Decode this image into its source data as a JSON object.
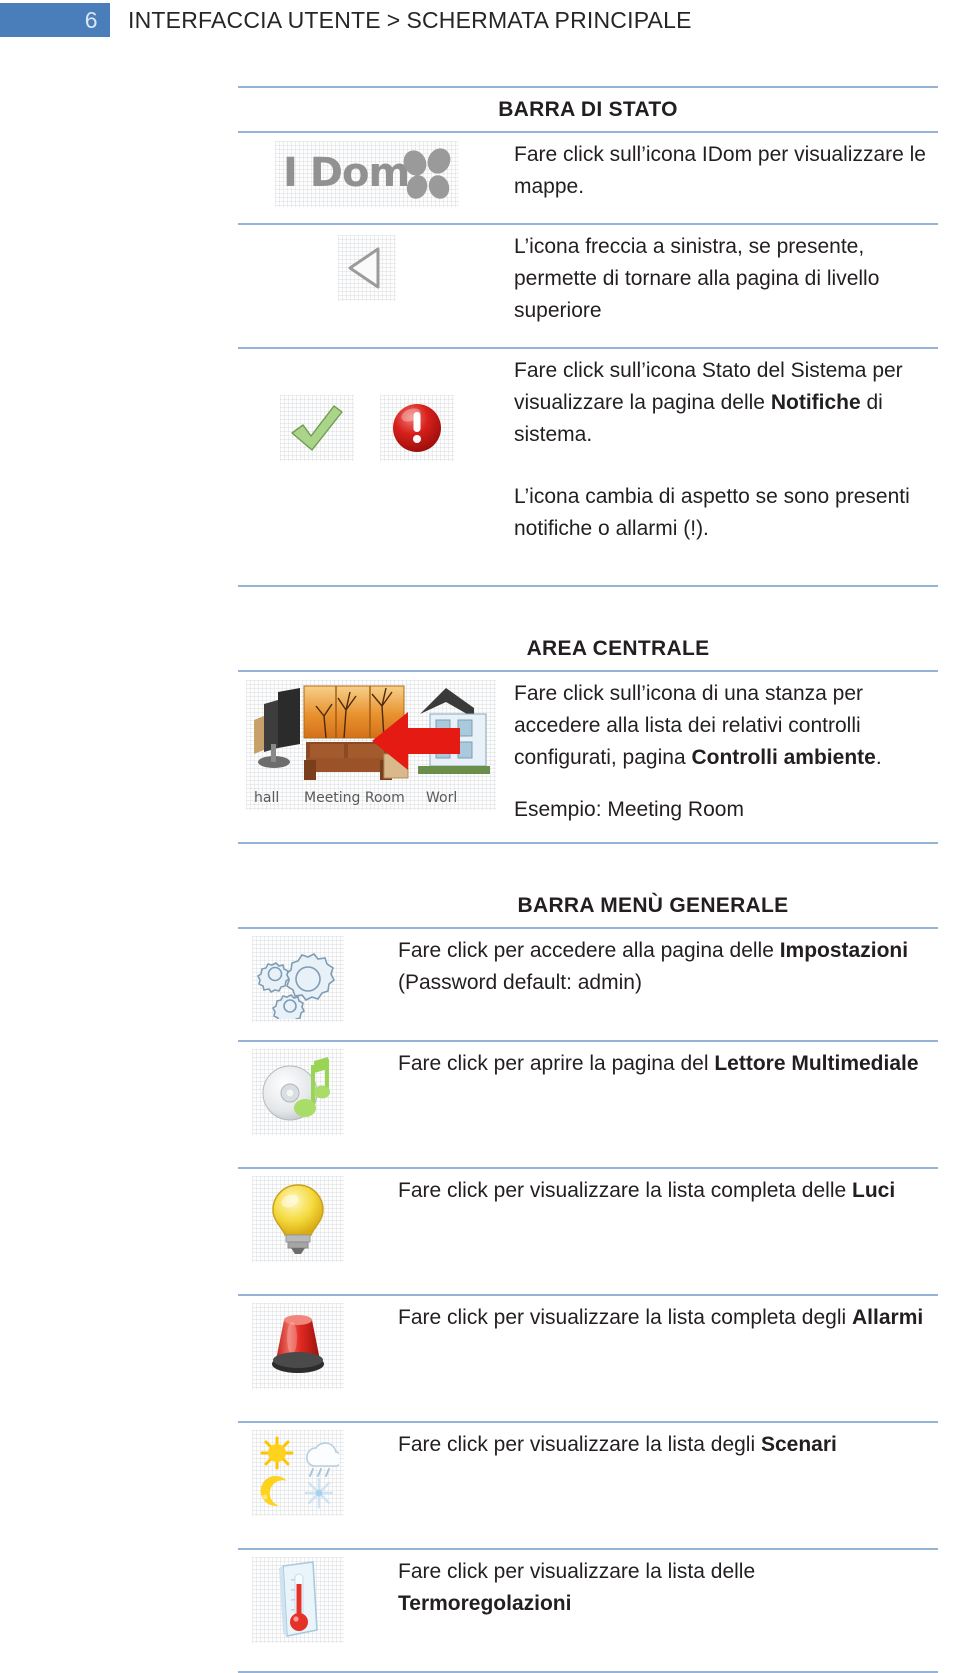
{
  "header": {
    "page_number": "6",
    "breadcrumb_first": "INTERFACCIA UTENTE",
    "breadcrumb_separator": ">",
    "breadcrumb_second": "SCHERMATA PRINCIPALE",
    "accent_color": "#4a7ebb",
    "number_color": "#dce6f2"
  },
  "rule_color": "#95b3d7",
  "sections": {
    "status_bar": "BARRA DI STATO",
    "central_area": "AREA CENTRALE",
    "general_menu": "BARRA MENÙ GENERALE"
  },
  "rows": {
    "idom": {
      "icon_name": "idom-logo-icon",
      "logo_text": "I Dom",
      "text_plain": "Fare click sull’icona IDom per visualizzare le mappe."
    },
    "back_arrow": {
      "icon_name": "back-arrow-icon",
      "text_plain": "L’icona freccia a sinistra, se presente, permette di tornare alla pagina di livello superiore"
    },
    "system_status": {
      "icon_ok_name": "green-check-icon",
      "icon_alert_name": "red-exclamation-icon",
      "line1_a": "Fare click sull’icona Stato del Sistema per visualizzare la pagina delle ",
      "line1_b": "Notifiche",
      "line1_c": " di sistema.",
      "line2": "L’icona cambia di aspetto se sono presenti notifiche o allarmi (!)."
    },
    "rooms": {
      "icon_name": "rooms-carousel-icon",
      "labels": [
        "hall",
        "Meeting Room",
        "Worl"
      ],
      "line1_a": "Fare click sull’icona di una stanza per accedere alla lista dei relativi controlli configurati, pagina ",
      "line1_b": "Controlli ambiente",
      "line1_c": ".",
      "line2": "Esempio: Meeting Room"
    },
    "settings": {
      "icon_name": "gears-icon",
      "text_a": "Fare click per accedere alla pagina delle ",
      "text_b": "Impostazioni",
      "text_c": "",
      "line2": "(Password default: admin)"
    },
    "media": {
      "icon_name": "cd-music-note-icon",
      "text_a": "Fare click per aprire la pagina del ",
      "text_b": "Lettore Multimediale",
      "text_c": ""
    },
    "lights": {
      "icon_name": "light-bulb-icon",
      "text_a": "Fare click per visualizzare la lista completa delle ",
      "text_b": "Luci",
      "text_c": ""
    },
    "alarms": {
      "icon_name": "siren-alarm-icon",
      "text_a": "Fare click per visualizzare la lista completa degli ",
      "text_b": "Allarmi",
      "text_c": ""
    },
    "scenarios": {
      "icon_name": "weather-scenarios-icon",
      "text_a": "Fare click per visualizzare la lista degli ",
      "text_b": "Scenari",
      "text_c": ""
    },
    "thermo": {
      "icon_name": "thermometer-icon",
      "text_a": "Fare click per visualizzare la lista delle ",
      "text_b": "Termoregolazioni",
      "text_c": ""
    }
  }
}
